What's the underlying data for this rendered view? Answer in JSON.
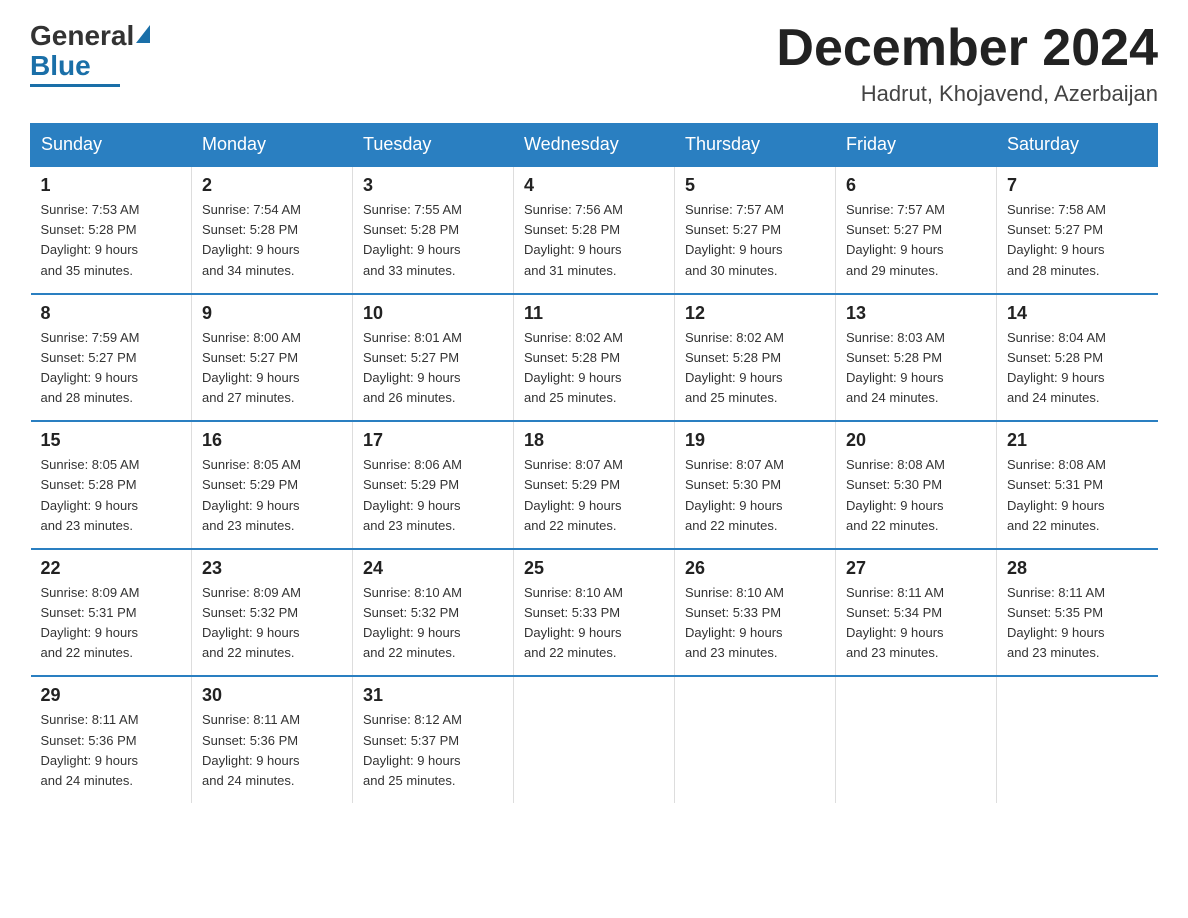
{
  "logo": {
    "general": "General",
    "blue": "Blue"
  },
  "header": {
    "title": "December 2024",
    "location": "Hadrut, Khojavend, Azerbaijan"
  },
  "days_of_week": [
    "Sunday",
    "Monday",
    "Tuesday",
    "Wednesday",
    "Thursday",
    "Friday",
    "Saturday"
  ],
  "weeks": [
    [
      {
        "day": "1",
        "sunrise": "7:53 AM",
        "sunset": "5:28 PM",
        "daylight": "9 hours and 35 minutes."
      },
      {
        "day": "2",
        "sunrise": "7:54 AM",
        "sunset": "5:28 PM",
        "daylight": "9 hours and 34 minutes."
      },
      {
        "day": "3",
        "sunrise": "7:55 AM",
        "sunset": "5:28 PM",
        "daylight": "9 hours and 33 minutes."
      },
      {
        "day": "4",
        "sunrise": "7:56 AM",
        "sunset": "5:28 PM",
        "daylight": "9 hours and 31 minutes."
      },
      {
        "day": "5",
        "sunrise": "7:57 AM",
        "sunset": "5:27 PM",
        "daylight": "9 hours and 30 minutes."
      },
      {
        "day": "6",
        "sunrise": "7:57 AM",
        "sunset": "5:27 PM",
        "daylight": "9 hours and 29 minutes."
      },
      {
        "day": "7",
        "sunrise": "7:58 AM",
        "sunset": "5:27 PM",
        "daylight": "9 hours and 28 minutes."
      }
    ],
    [
      {
        "day": "8",
        "sunrise": "7:59 AM",
        "sunset": "5:27 PM",
        "daylight": "9 hours and 28 minutes."
      },
      {
        "day": "9",
        "sunrise": "8:00 AM",
        "sunset": "5:27 PM",
        "daylight": "9 hours and 27 minutes."
      },
      {
        "day": "10",
        "sunrise": "8:01 AM",
        "sunset": "5:27 PM",
        "daylight": "9 hours and 26 minutes."
      },
      {
        "day": "11",
        "sunrise": "8:02 AM",
        "sunset": "5:28 PM",
        "daylight": "9 hours and 25 minutes."
      },
      {
        "day": "12",
        "sunrise": "8:02 AM",
        "sunset": "5:28 PM",
        "daylight": "9 hours and 25 minutes."
      },
      {
        "day": "13",
        "sunrise": "8:03 AM",
        "sunset": "5:28 PM",
        "daylight": "9 hours and 24 minutes."
      },
      {
        "day": "14",
        "sunrise": "8:04 AM",
        "sunset": "5:28 PM",
        "daylight": "9 hours and 24 minutes."
      }
    ],
    [
      {
        "day": "15",
        "sunrise": "8:05 AM",
        "sunset": "5:28 PM",
        "daylight": "9 hours and 23 minutes."
      },
      {
        "day": "16",
        "sunrise": "8:05 AM",
        "sunset": "5:29 PM",
        "daylight": "9 hours and 23 minutes."
      },
      {
        "day": "17",
        "sunrise": "8:06 AM",
        "sunset": "5:29 PM",
        "daylight": "9 hours and 23 minutes."
      },
      {
        "day": "18",
        "sunrise": "8:07 AM",
        "sunset": "5:29 PM",
        "daylight": "9 hours and 22 minutes."
      },
      {
        "day": "19",
        "sunrise": "8:07 AM",
        "sunset": "5:30 PM",
        "daylight": "9 hours and 22 minutes."
      },
      {
        "day": "20",
        "sunrise": "8:08 AM",
        "sunset": "5:30 PM",
        "daylight": "9 hours and 22 minutes."
      },
      {
        "day": "21",
        "sunrise": "8:08 AM",
        "sunset": "5:31 PM",
        "daylight": "9 hours and 22 minutes."
      }
    ],
    [
      {
        "day": "22",
        "sunrise": "8:09 AM",
        "sunset": "5:31 PM",
        "daylight": "9 hours and 22 minutes."
      },
      {
        "day": "23",
        "sunrise": "8:09 AM",
        "sunset": "5:32 PM",
        "daylight": "9 hours and 22 minutes."
      },
      {
        "day": "24",
        "sunrise": "8:10 AM",
        "sunset": "5:32 PM",
        "daylight": "9 hours and 22 minutes."
      },
      {
        "day": "25",
        "sunrise": "8:10 AM",
        "sunset": "5:33 PM",
        "daylight": "9 hours and 22 minutes."
      },
      {
        "day": "26",
        "sunrise": "8:10 AM",
        "sunset": "5:33 PM",
        "daylight": "9 hours and 23 minutes."
      },
      {
        "day": "27",
        "sunrise": "8:11 AM",
        "sunset": "5:34 PM",
        "daylight": "9 hours and 23 minutes."
      },
      {
        "day": "28",
        "sunrise": "8:11 AM",
        "sunset": "5:35 PM",
        "daylight": "9 hours and 23 minutes."
      }
    ],
    [
      {
        "day": "29",
        "sunrise": "8:11 AM",
        "sunset": "5:36 PM",
        "daylight": "9 hours and 24 minutes."
      },
      {
        "day": "30",
        "sunrise": "8:11 AM",
        "sunset": "5:36 PM",
        "daylight": "9 hours and 24 minutes."
      },
      {
        "day": "31",
        "sunrise": "8:12 AM",
        "sunset": "5:37 PM",
        "daylight": "9 hours and 25 minutes."
      },
      null,
      null,
      null,
      null
    ]
  ]
}
